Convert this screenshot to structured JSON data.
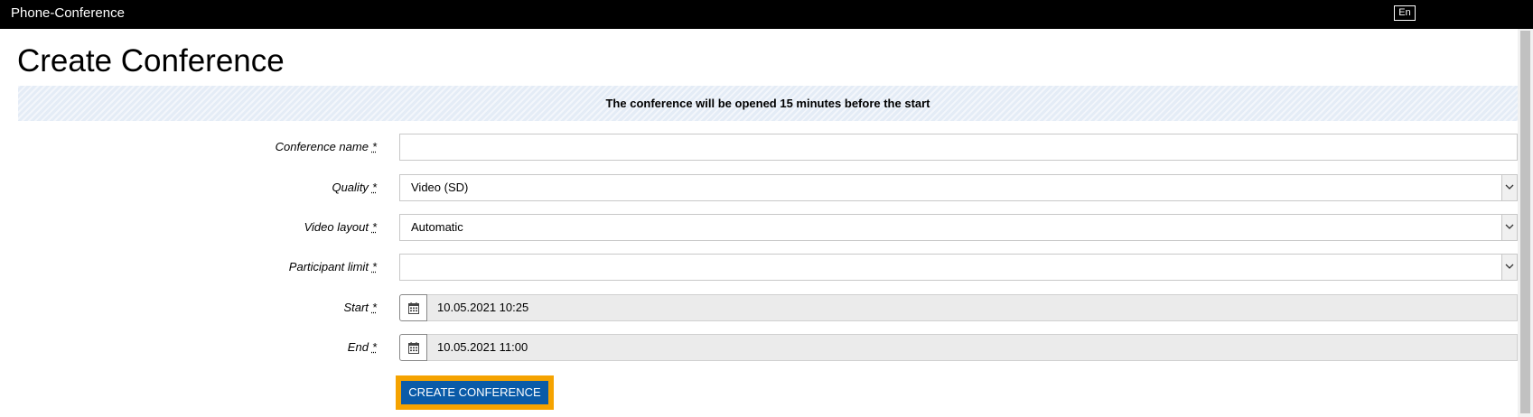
{
  "header": {
    "app_title": "Phone-Conference",
    "language": "En"
  },
  "page": {
    "title": "Create Conference",
    "info_banner": "The conference will be opened 15 minutes before the start"
  },
  "form": {
    "required_marker": "*",
    "conference_name": {
      "label": "Conference name",
      "value": "",
      "placeholder": ""
    },
    "quality": {
      "label": "Quality",
      "value": "Video (SD)"
    },
    "video_layout": {
      "label": "Video layout",
      "value": "Automatic"
    },
    "participant_limit": {
      "label": "Participant limit",
      "value": ""
    },
    "start": {
      "label": "Start",
      "value": "10.05.2021 10:25"
    },
    "end": {
      "label": "End",
      "value": "10.05.2021 11:00"
    },
    "submit_label": "CREATE CONFERENCE"
  },
  "colors": {
    "topbar": "#000000",
    "banner": "#e4ecf6",
    "button": "#0a5ba8",
    "focus_outline": "#f5a300"
  }
}
